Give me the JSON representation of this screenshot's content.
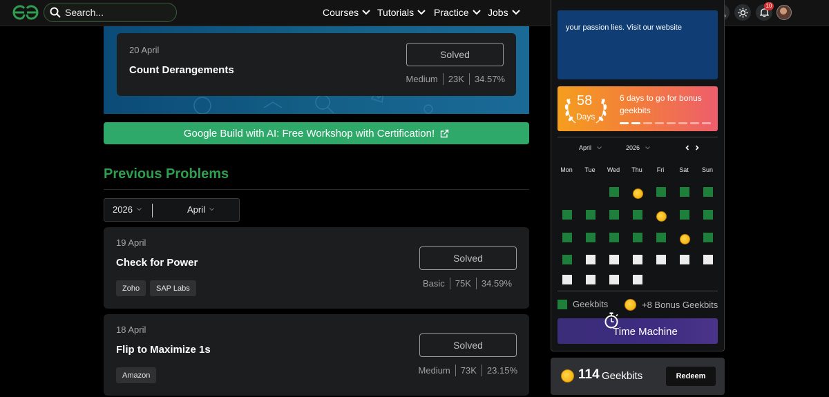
{
  "nav": {
    "search_placeholder": "Search...",
    "menu": [
      "Courses",
      "Tutorials",
      "Practice",
      "Jobs"
    ],
    "notification_count": "10"
  },
  "potd": {
    "date": "20 April",
    "title": "Count Derangements",
    "status": "Solved",
    "difficulty": "Medium",
    "submissions": "23K",
    "accuracy": "34.57%"
  },
  "promo": {
    "text": "Google Build with AI: Free Workshop with Certification!"
  },
  "previous": {
    "title": "Previous Problems",
    "year": "2026",
    "month": "April",
    "problems": [
      {
        "date": "19 April",
        "title": "Check for Power",
        "status": "Solved",
        "difficulty": "Basic",
        "submissions": "75K",
        "accuracy": "34.59%",
        "tags": [
          "Zoho",
          "SAP Labs"
        ]
      },
      {
        "date": "18 April",
        "title": "Flip to Maximize 1s",
        "status": "Solved",
        "difficulty": "Medium",
        "submissions": "73K",
        "accuracy": "23.15%",
        "tags": [
          "Amazon"
        ]
      }
    ]
  },
  "sidebar": {
    "ad_text": "your passion lies. Visit our website",
    "streak": {
      "days": "58",
      "days_label": "Days",
      "message": "6 days to go for bonus geekbits",
      "filled_steps": 2,
      "total_steps": 8
    },
    "calendar": {
      "month": "April",
      "year": "2026",
      "weekdays": [
        "Mon",
        "Tue",
        "Wed",
        "Thu",
        "Fri",
        "Sat",
        "Sun"
      ],
      "weeks": [
        [
          "",
          "",
          "solved",
          "bonus",
          "solved",
          "solved",
          "solved"
        ],
        [
          "solved",
          "solved",
          "solved",
          "solved",
          "bonus",
          "solved",
          "solved"
        ],
        [
          "solved",
          "solved",
          "solved",
          "solved",
          "solved",
          "bonus",
          "solved"
        ],
        [
          "solved",
          "upcoming",
          "upcoming",
          "upcoming",
          "upcoming",
          "upcoming",
          "upcoming"
        ],
        [
          "upcoming",
          "upcoming",
          "upcoming",
          "upcoming",
          "",
          "",
          ""
        ]
      ]
    },
    "legend": {
      "geekbits": "Geekbits",
      "bonus": "+8 Bonus Geekbits"
    },
    "time_machine": "Time Machine",
    "geekbits": {
      "count": "114",
      "label": "Geekbits",
      "redeem": "Redeem"
    }
  },
  "colors": {
    "accent_green": "#2f9e50",
    "promo_green": "#2fa96a",
    "calendar_green": "#1d7f3a",
    "coin_gold": "#ffc21a"
  }
}
